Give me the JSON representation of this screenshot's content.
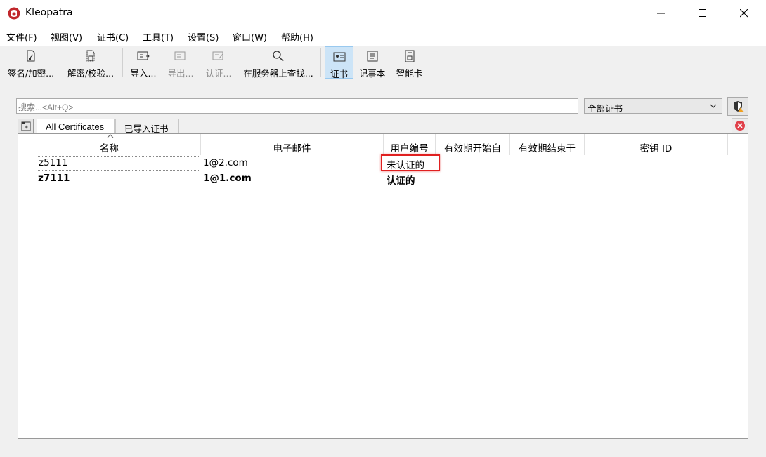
{
  "window": {
    "title": "Kleopatra",
    "icon": "kleopatra-logo-icon"
  },
  "menu": [
    "文件(F)",
    "视图(V)",
    "证书(C)",
    "工具(T)",
    "设置(S)",
    "窗口(W)",
    "帮助(H)"
  ],
  "toolbar": {
    "sign_encrypt": "签名/加密...",
    "decrypt_verify": "解密/校验...",
    "import": "导入...",
    "export": "导出...",
    "certify": "认证...",
    "lookup_server": "在服务器上查找...",
    "certificates": "证书",
    "notepad": "记事本",
    "smartcard": "智能卡"
  },
  "search": {
    "placeholder": "搜索...<Alt+Q>"
  },
  "filter": {
    "selected": "全部证书"
  },
  "tabs": [
    "All Certificates",
    "已导入证书"
  ],
  "table": {
    "columns": [
      "名称",
      "电子邮件",
      "用户编号",
      "有效期开始自",
      "有效期结束于",
      "密钥 ID"
    ],
    "rows": [
      {
        "name": "z5111",
        "email": "1@2.com",
        "user_id": "未认证的",
        "bold": false
      },
      {
        "name": "z7111",
        "email": "1@1.com",
        "user_id": "认证的",
        "bold": true
      }
    ]
  },
  "colors": {
    "highlight": "#e02020",
    "active_tool": "#cce4f7"
  }
}
